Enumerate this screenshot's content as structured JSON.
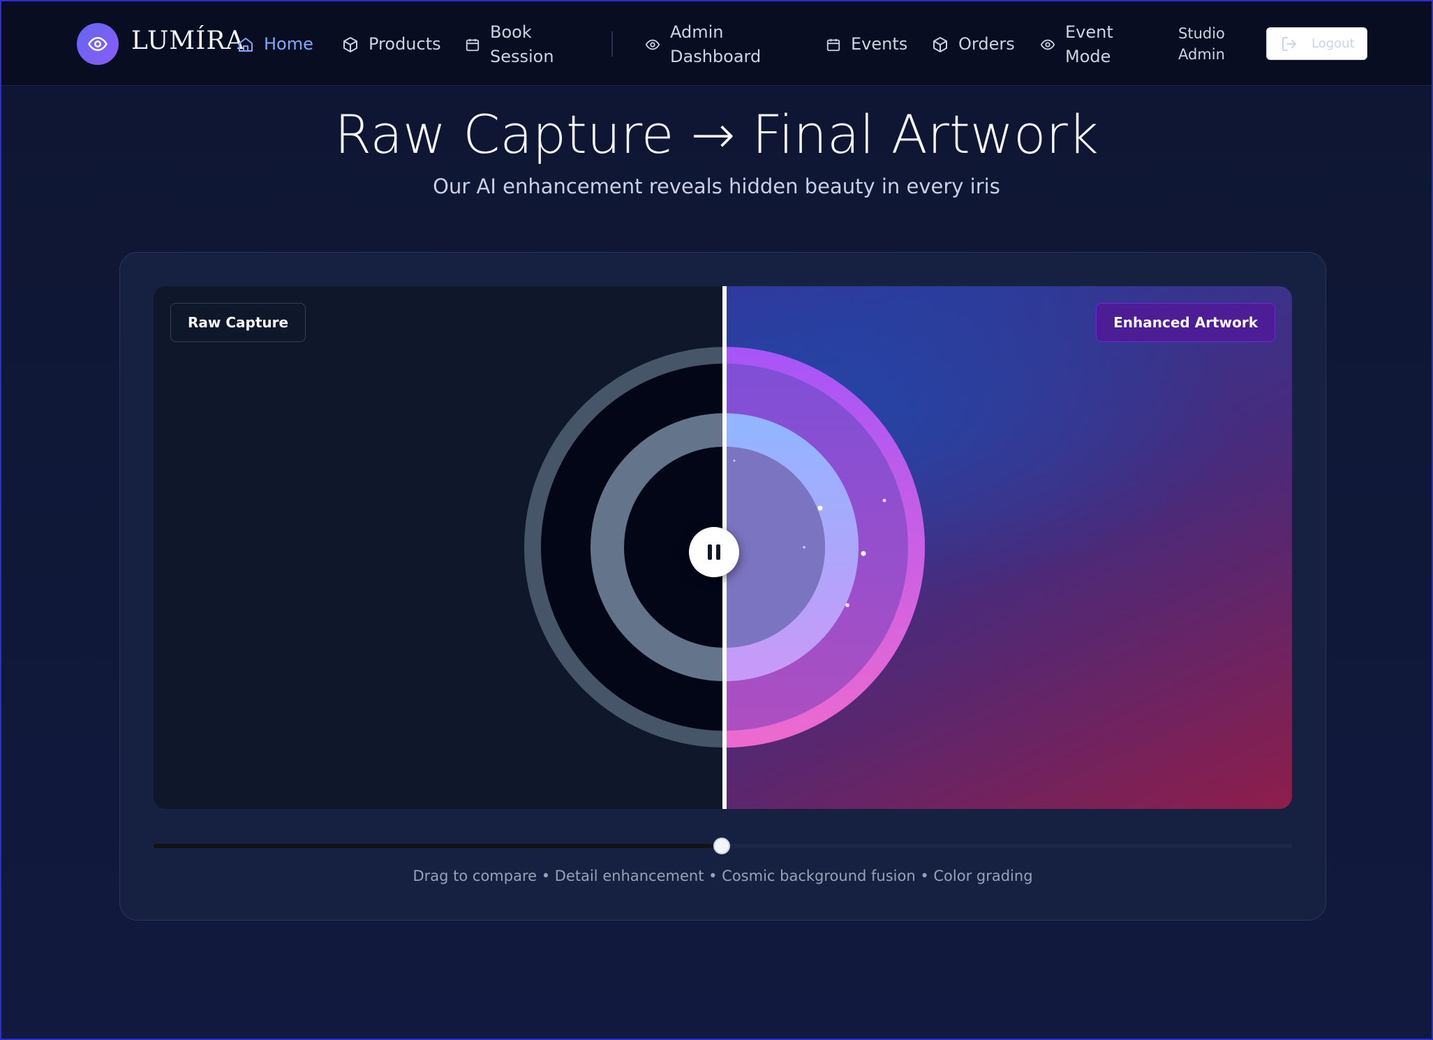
{
  "nav": {
    "brand": "LUMÍRA",
    "items": [
      {
        "label": "Home",
        "icon": "home-icon",
        "active": true
      },
      {
        "label": "Products",
        "icon": "box-icon"
      },
      {
        "label": "Book\nSession",
        "icon": "calendar-icon"
      },
      {
        "label": "Admin\nDashboard",
        "icon": "eye-icon"
      },
      {
        "label": "Events",
        "icon": "calendar-icon"
      },
      {
        "label": "Orders",
        "icon": "box-icon"
      },
      {
        "label": "Event\nMode",
        "icon": "eye-icon"
      }
    ],
    "user": "Studio\nAdmin",
    "logout": "Logout"
  },
  "hero": {
    "title": "Raw Capture → Final Artwork",
    "subtitle": "Our AI enhancement reveals hidden beauty in every iris"
  },
  "compare": {
    "left_label": "Raw Capture",
    "right_label": "Enhanced Artwork",
    "slider_position": 0.5,
    "caption": "Drag to compare • Detail enhancement • Cosmic background fusion • Color grading"
  },
  "colors": {
    "accent": "#7da9ff",
    "enhanced_badge": "#4c1d95",
    "background": "#0f1838"
  }
}
